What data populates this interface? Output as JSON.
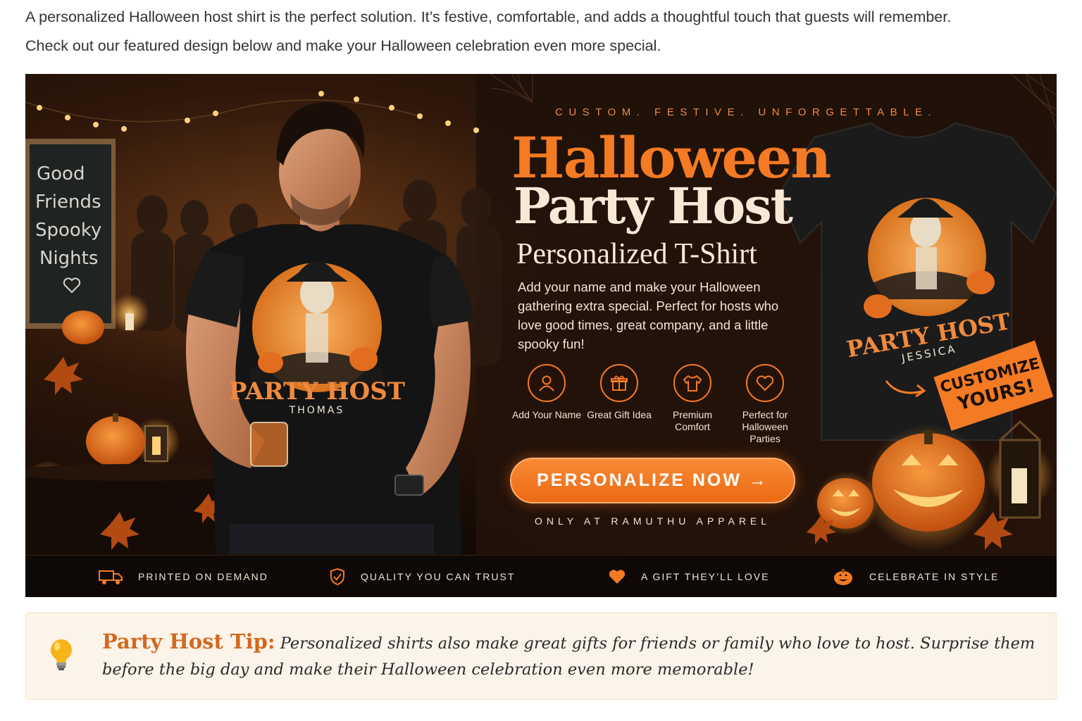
{
  "intro": {
    "line1": "A personalized Halloween host shirt is the perfect solution. It’s festive, comfortable, and adds a thoughtful touch that guests will remember.",
    "line2": "Check out our featured design below and make your Halloween celebration even more special."
  },
  "banner": {
    "chalkboard": [
      "Good",
      "Friends",
      "Spooky",
      "Nights"
    ],
    "model_shirt": {
      "title": "PARTY HOST",
      "name": "THOMAS"
    },
    "tagline": "CUSTOM. FESTIVE. UNFORGETTABLE.",
    "headline_1": "Halloween",
    "headline_2": "Party Host",
    "headline_3": "Personalized T-Shirt",
    "description": "Add your name and make your Halloween gathering extra special. Perfect for hosts who love good times, great company, and a little spooky fun!",
    "features": [
      {
        "icon": "user-icon",
        "label": "Add Your Name"
      },
      {
        "icon": "gift-icon",
        "label": "Great Gift Idea"
      },
      {
        "icon": "tshirt-icon",
        "label": "Premium Comfort"
      },
      {
        "icon": "heart-icon",
        "label": "Perfect for Halloween Parties"
      }
    ],
    "cta_label": "PERSONALIZE NOW →",
    "only_at": "ONLY AT RAMUTHU APPAREL",
    "product_shirt": {
      "title": "PARTY HOST",
      "name": "JESSICA"
    },
    "customize_badge": [
      "CUSTOMIZE",
      "YOURS!"
    ]
  },
  "strip": [
    {
      "icon": "truck-icon",
      "label": "PRINTED ON DEMAND"
    },
    {
      "icon": "shield-check-icon",
      "label": "QUALITY YOU CAN TRUST"
    },
    {
      "icon": "heart-icon",
      "label": "A GIFT THEY’LL LOVE"
    },
    {
      "icon": "pumpkin-icon",
      "label": "CELEBRATE IN STYLE"
    }
  ],
  "tip": {
    "title": "Party Host Tip:",
    "body": "Personalized shirts also make great gifts for friends or family who love to host. Surprise them before the big day and make their Halloween celebration even more memorable!"
  },
  "colors": {
    "accent": "#f47a23",
    "dark": "#120a05",
    "cream": "#f6ead7",
    "tip_bg": "#fdf4e9"
  }
}
